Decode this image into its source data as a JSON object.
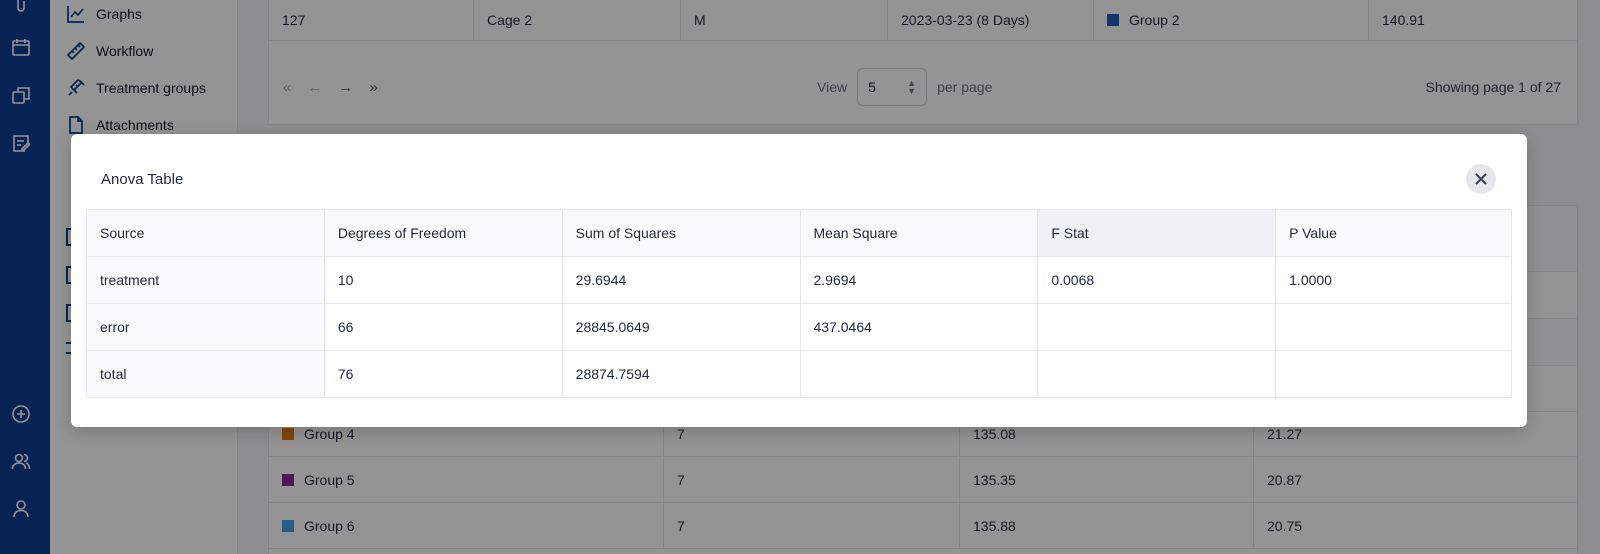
{
  "rail_icons": [
    "clip-icon",
    "calendar-icon",
    "copy-icon",
    "checklist-icon",
    "plus-circle-icon",
    "users-icon",
    "user-icon"
  ],
  "nav": {
    "items": [
      {
        "label": "Graphs",
        "icon": "line-chart-icon"
      },
      {
        "label": "Workflow",
        "icon": "ruler-icon"
      },
      {
        "label": "Treatment groups",
        "icon": "syringe-icon"
      },
      {
        "label": "Attachments",
        "icon": "file-icon"
      }
    ]
  },
  "background_table": {
    "top_row": {
      "id": "127",
      "cage": "Cage 2",
      "sex": "M",
      "date": "2023-03-23 (8 Days)",
      "group": "Group 2",
      "group_color": "#1d5fb3",
      "weight": "140.91"
    },
    "pagination": {
      "first": "«",
      "prev": "←",
      "next": "→",
      "last": "»",
      "view_label": "View",
      "per_page_value": "5",
      "per_page_label": "per page",
      "page_info": "Showing page 1 of 27"
    }
  },
  "group_summary": {
    "rows": [
      {
        "group": "Group 4",
        "color": "#e07b14",
        "n": "7",
        "mean": "135.08",
        "sd": "21.27"
      },
      {
        "group": "Group 5",
        "color": "#7b2f9b",
        "n": "7",
        "mean": "135.35",
        "sd": "20.87"
      },
      {
        "group": "Group 6",
        "color": "#4a9de0",
        "n": "7",
        "mean": "135.88",
        "sd": "20.75"
      }
    ]
  },
  "modal": {
    "title": "Anova Table",
    "close_icon": "close-icon",
    "columns": [
      "Source",
      "Degrees of Freedom",
      "Sum of Squares",
      "Mean Square",
      "F Stat",
      "P Value"
    ],
    "rows": [
      [
        "treatment",
        "10",
        "29.6944",
        "2.9694",
        "0.0068",
        "1.0000"
      ],
      [
        "error",
        "66",
        "28845.0649",
        "437.0464",
        "",
        ""
      ],
      [
        "total",
        "76",
        "28874.7594",
        "",
        "",
        ""
      ]
    ]
  }
}
